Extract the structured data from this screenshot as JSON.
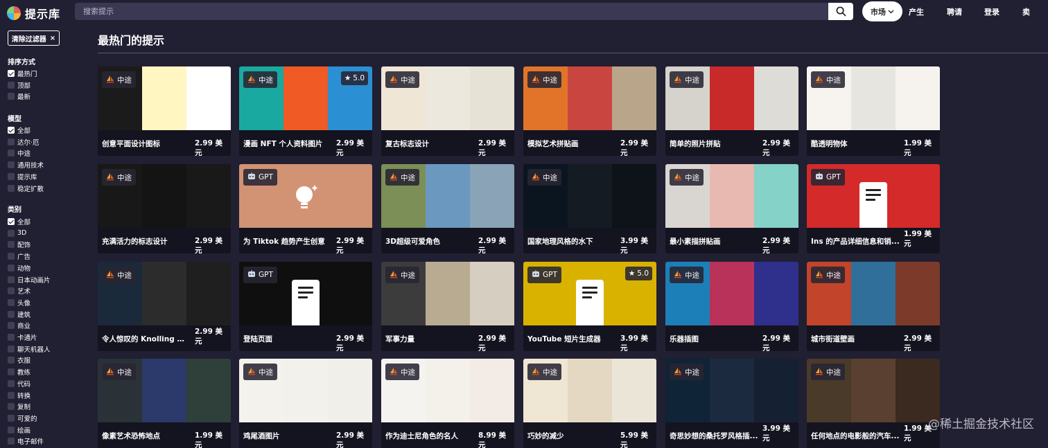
{
  "app": {
    "title": "提示库",
    "logo_icon": "brain-logo-icon"
  },
  "search": {
    "placeholder": "搜索提示"
  },
  "nav": {
    "market": "市场",
    "create": "产生",
    "hire": "聘请",
    "login": "登录",
    "sell": "卖"
  },
  "sidebar": {
    "clear_filters": "清除过滤器",
    "sort_title": "排序方式",
    "sort": [
      {
        "label": "最热门",
        "checked": true
      },
      {
        "label": "顶部",
        "checked": false
      },
      {
        "label": "最新",
        "checked": false
      }
    ],
    "model_title": "模型",
    "models": [
      {
        "label": "全部",
        "checked": true
      },
      {
        "label": "达尔·厄",
        "checked": false
      },
      {
        "label": "中途",
        "checked": false
      },
      {
        "label": "通用技术",
        "checked": false
      },
      {
        "label": "提示库",
        "checked": false
      },
      {
        "label": "稳定扩散",
        "checked": false
      }
    ],
    "category_title": "类别",
    "categories": [
      {
        "label": "全部",
        "checked": true
      },
      {
        "label": "3D"
      },
      {
        "label": "配饰"
      },
      {
        "label": "广告"
      },
      {
        "label": "动物"
      },
      {
        "label": "日本动画片"
      },
      {
        "label": "艺术"
      },
      {
        "label": "头像"
      },
      {
        "label": "建筑"
      },
      {
        "label": "商业"
      },
      {
        "label": "卡通片"
      },
      {
        "label": "聊天机器人"
      },
      {
        "label": "衣服"
      },
      {
        "label": "教练"
      },
      {
        "label": "代码"
      },
      {
        "label": "转换"
      },
      {
        "label": "复制"
      },
      {
        "label": "可爱的"
      },
      {
        "label": "绘画"
      },
      {
        "label": "电子邮件"
      }
    ]
  },
  "main": {
    "title": "最热门的提示"
  },
  "cards": [
    {
      "name": "创意平面设计图标",
      "price": "2.99 美元",
      "badge": "中途",
      "colors": [
        "#1b1b1b",
        "#fff6c2",
        "#ffffff"
      ]
    },
    {
      "name": "漫画 NFT 个人资料图片",
      "price": "2.99 美元",
      "badge": "中途",
      "rating": "5.0",
      "colors": [
        "#19a9a0",
        "#f05a24",
        "#2b8fd4"
      ]
    },
    {
      "name": "复古标志设计",
      "price": "2.99 美元",
      "badge": "中途",
      "colors": [
        "#efe6d6",
        "#ece8de",
        "#e7e2d6"
      ]
    },
    {
      "name": "模拟艺术拼贴画",
      "price": "2.99 美元",
      "badge": "中途",
      "colors": [
        "#e2742a",
        "#c94540",
        "#b9a58a"
      ]
    },
    {
      "name": "简单的照片拼贴",
      "price": "2.99 美元",
      "badge": "中途",
      "colors": [
        "#d6d3cd",
        "#c82a2a",
        "#dedcd7"
      ]
    },
    {
      "name": "酷透明物体",
      "price": "1.99 美元",
      "badge": "中途",
      "colors": [
        "#f7f4ef",
        "#e7e5e0",
        "#f6f3ee"
      ]
    },
    {
      "name": "充满活力的标志设计",
      "price": "2.99 美元",
      "badge": "中途",
      "colors": [
        "#181818",
        "#141414",
        "#191919"
      ]
    },
    {
      "name": "为 Tiktok 趋势产生创意",
      "price": "2.99 美元",
      "badge": "GPT",
      "single": "#d19374",
      "icon": "lightbulb-icon"
    },
    {
      "name": "3D超级可爱角色",
      "price": "2.99 美元",
      "badge": "中途",
      "colors": [
        "#7b8f56",
        "#6b98bf",
        "#8aa3b6"
      ]
    },
    {
      "name": "国家地理风格的水下",
      "price": "3.99 美元",
      "badge": "中途",
      "colors": [
        "#0b1520",
        "#151b22",
        "#0d1318"
      ]
    },
    {
      "name": "最小素描拼贴画",
      "price": "2.99 美元",
      "badge": "中途",
      "colors": [
        "#d9d6d2",
        "#e8b9b1",
        "#85d2c8"
      ]
    },
    {
      "name": "Ins 的产品详细信息和销...",
      "price": "1.99 美元",
      "badge": "GPT",
      "single": "#d42a2a",
      "icon": "document-icon",
      "wrap": true
    },
    {
      "name": "令人惊叹的 Knolling 对象...",
      "price": "2.99 美元",
      "badge": "中途",
      "colors": [
        "#1b2a3a",
        "#2c2c2c",
        "#1f1f1f"
      ],
      "wrap": true
    },
    {
      "name": "登陆页面",
      "price": "2.99 美元",
      "badge": "GPT",
      "single": "#0f0f0f",
      "icon": "document-icon"
    },
    {
      "name": "军事力量",
      "price": "2.99 美元",
      "badge": "中途",
      "colors": [
        "#3c3c3c",
        "#b8ab92",
        "#d6cfc1"
      ]
    },
    {
      "name": "YouTube 短片生成器",
      "price": "3.99 美元",
      "badge": "GPT",
      "rating": "5.0",
      "single": "#d9b200",
      "icon": "document-icon"
    },
    {
      "name": "乐器插图",
      "price": "2.99 美元",
      "badge": "中途",
      "colors": [
        "#1d7fb8",
        "#b8325a",
        "#2f2f8c"
      ]
    },
    {
      "name": "城市街道壁画",
      "price": "2.99 美元",
      "badge": "中途",
      "colors": [
        "#c2442a",
        "#2f6f9a",
        "#7c3a2a"
      ]
    },
    {
      "name": "像素艺术恐怖地点",
      "price": "1.99 美元",
      "badge": "中途",
      "colors": [
        "#2a3238",
        "#2b3a6a",
        "#2f3f3a"
      ]
    },
    {
      "name": "鸡尾酒图片",
      "price": "2.99 美元",
      "badge": "中途",
      "colors": [
        "#f4f2ec",
        "#f3f1ec",
        "#f1efe9"
      ]
    },
    {
      "name": "作为迪士尼角色的名人",
      "price": "8.99 美元",
      "badge": "中途",
      "colors": [
        "#f5f3f0",
        "#f4f0ea",
        "#f3ebe6"
      ]
    },
    {
      "name": "巧妙的减少",
      "price": "5.99 美元",
      "badge": "中途",
      "colors": [
        "#efe6d3",
        "#e4d8c3",
        "#ebe5d8"
      ]
    },
    {
      "name": "奇思妙想的桑托罗风格插...",
      "price": "3.99 美元",
      "badge": "中途",
      "colors": [
        "#0f2436",
        "#1c2a40",
        "#152033"
      ],
      "wrap": true
    },
    {
      "name": "任何地点的电影般的汽车...",
      "price": "1.99 美元",
      "badge": "中途",
      "colors": [
        "#4a3a2a",
        "#5a4030",
        "#3a2a20"
      ],
      "wrap": true
    }
  ],
  "watermark": "@稀土掘金技术社区"
}
